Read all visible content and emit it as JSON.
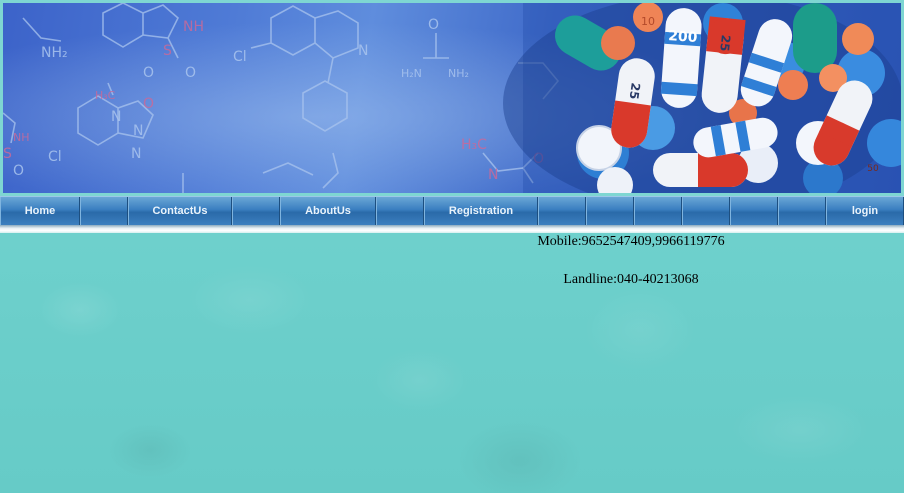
{
  "banner": {
    "chem_labels": [
      "NH",
      "NH₂",
      "S",
      "O",
      "O",
      "Cl",
      "N",
      "N",
      "O",
      "H₂N",
      "NH₂",
      "H₃C",
      "N",
      "O",
      "Cl",
      "N",
      "NH",
      "S",
      "O",
      "H₃C",
      "N",
      "O"
    ],
    "pill_labels": [
      "10",
      "200",
      "25",
      "25",
      "50"
    ]
  },
  "nav": {
    "items": [
      {
        "label": "Home"
      },
      {
        "label": ""
      },
      {
        "label": "ContactUs"
      },
      {
        "label": ""
      },
      {
        "label": "AboutUs"
      },
      {
        "label": ""
      },
      {
        "label": "Registration"
      },
      {
        "label": ""
      },
      {
        "label": ""
      },
      {
        "label": ""
      },
      {
        "label": ""
      },
      {
        "label": ""
      },
      {
        "label": ""
      },
      {
        "label": "login"
      }
    ]
  },
  "contact": {
    "mobile": "Mobile:9652547409,9966119776",
    "landline": "Landline:040-40213068"
  }
}
